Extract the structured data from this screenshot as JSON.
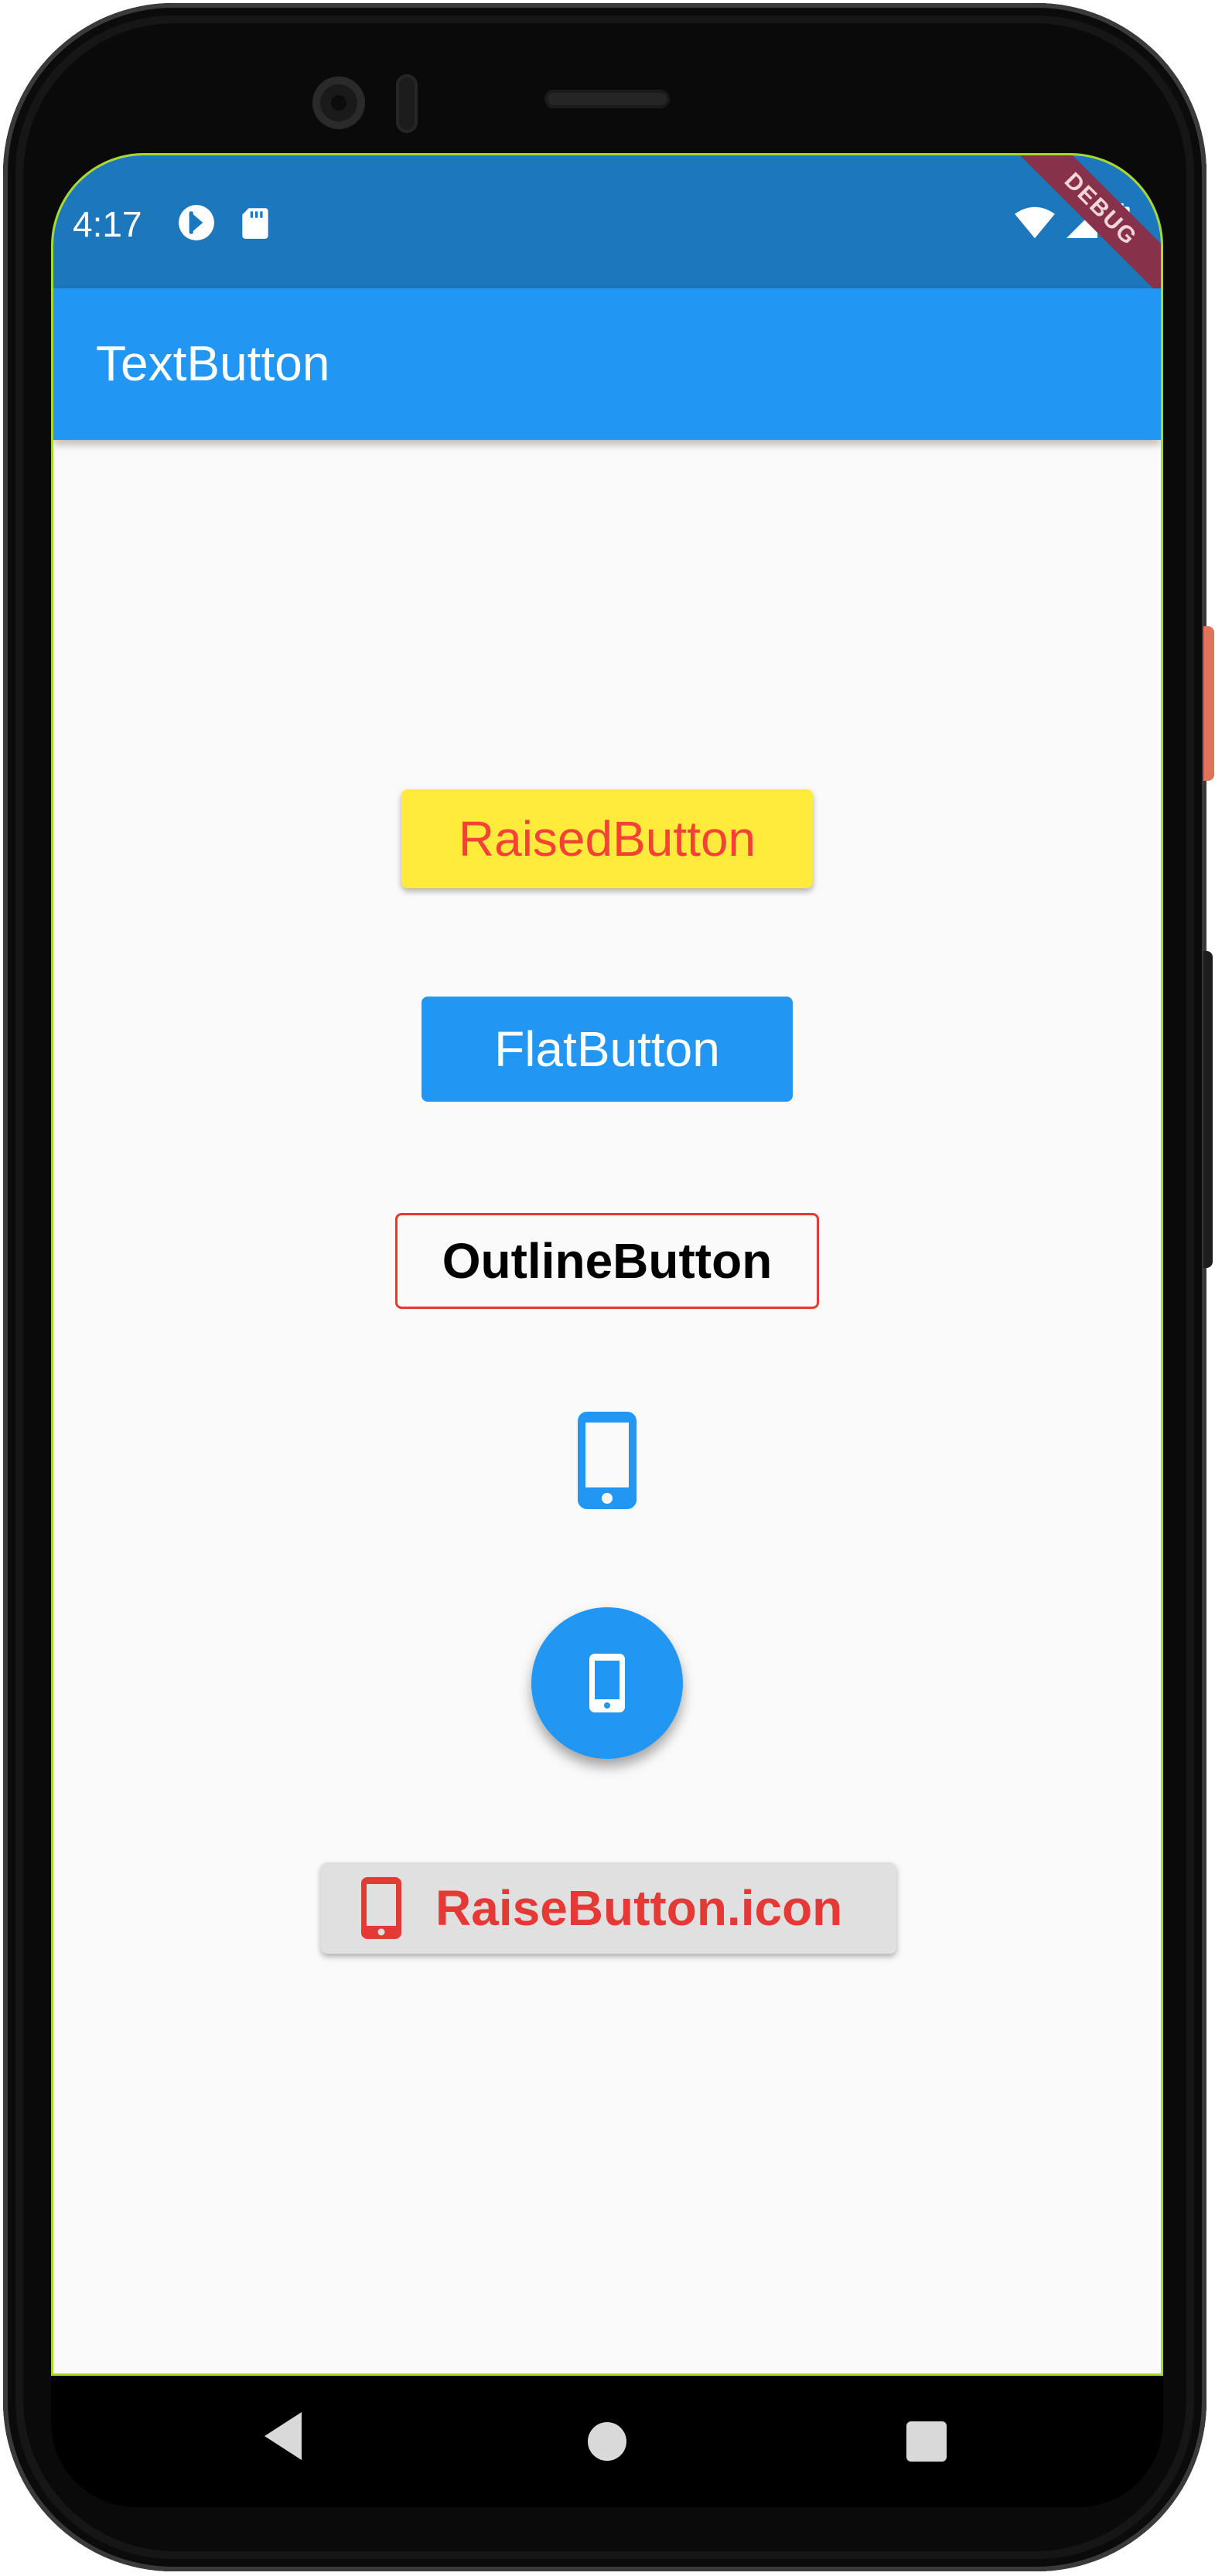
{
  "status_bar": {
    "time": "4:17",
    "left_icons": [
      "play-store-icon",
      "sd-card-icon"
    ],
    "right_icons": [
      "wifi-icon",
      "signal-icon",
      "battery-icon"
    ],
    "debug_banner": "DEBUG"
  },
  "app_bar": {
    "title": "TextButton"
  },
  "buttons": {
    "raised_label": "RaisedButton",
    "flat_label": "FlatButton",
    "outline_label": "OutlineButton",
    "icon_button_icon": "smartphone-icon",
    "fab_icon": "smartphone-icon",
    "raise_icon_label": "RaiseButton.icon",
    "raise_icon_icon": "smartphone-icon"
  },
  "nav_bar": {
    "icons": [
      "back-icon",
      "home-icon",
      "recents-icon"
    ]
  },
  "colors": {
    "status_bar": "#1c77bd",
    "app_bar": "#2196f3",
    "raised_bg": "#ffeb3b",
    "raised_text": "#f44336",
    "flat_bg": "#2196f3",
    "outline_border": "#e53935",
    "raise_icon_bg": "#e0e0e0",
    "raise_icon_text": "#e53935"
  }
}
